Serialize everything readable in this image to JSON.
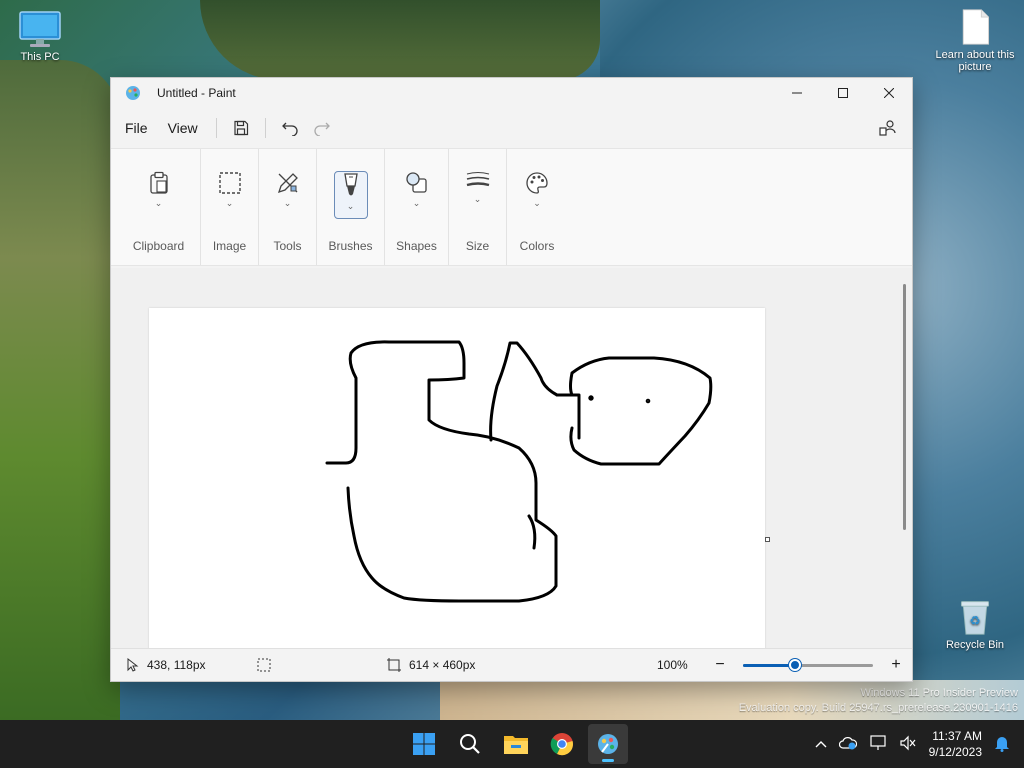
{
  "desktop": {
    "icons": {
      "this_pc": "This PC",
      "learn": "Learn about this picture",
      "recycle_bin": "Recycle Bin"
    },
    "watermark": {
      "line1": "Windows 11 Pro Insider Preview",
      "line2": "Evaluation copy. Build 25947.rs_prerelease.230901-1416"
    }
  },
  "window": {
    "title": "Untitled - Paint",
    "menu": {
      "file": "File",
      "view": "View"
    },
    "ribbon": {
      "clipboard": "Clipboard",
      "image": "Image",
      "tools": "Tools",
      "brushes": "Brushes",
      "shapes": "Shapes",
      "size": "Size",
      "colors": "Colors"
    },
    "status": {
      "cursor_position": "438, 118px",
      "canvas_size": "614 × 460px",
      "zoom": "100%",
      "zoom_level": 0.4
    }
  },
  "taskbar": {
    "apps": [
      "start-icon",
      "search-icon",
      "file-explorer-icon",
      "chrome-icon",
      "paint-icon"
    ],
    "time": "11:37 AM",
    "date": "9/12/2023"
  },
  "colors": {
    "accent": "#0a5fb4",
    "taskbar": "#202020"
  }
}
